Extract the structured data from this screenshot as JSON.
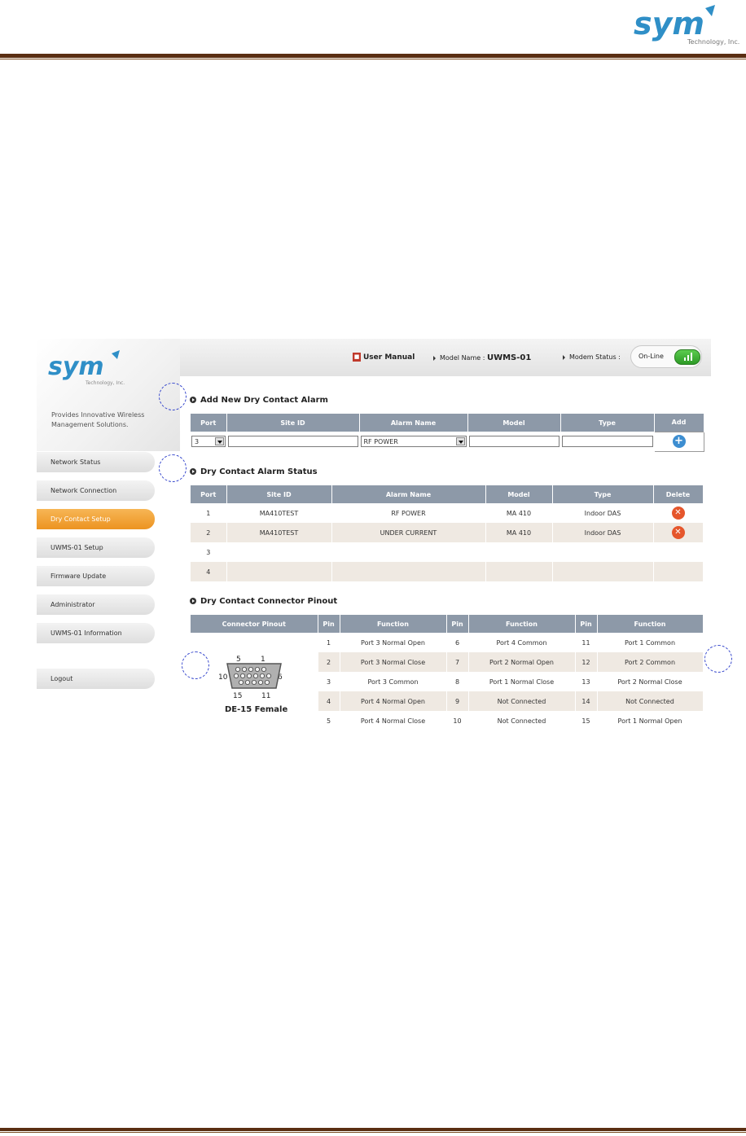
{
  "doc": {
    "logo_text": "sym",
    "logo_sub": "Technology, Inc."
  },
  "brand": {
    "logo_text": "sym",
    "logo_sub": "Technology, Inc.",
    "tagline": "Provides Innovative Wireless Management Solutions."
  },
  "header": {
    "user_manual": "User Manual",
    "model_label": "Model Name :",
    "model_value": "UWMS-01",
    "modem_label": "Modem Status :",
    "modem_value": "On-Line"
  },
  "sidebar": {
    "items": [
      {
        "label": "Network Status"
      },
      {
        "label": "Network Connection"
      },
      {
        "label": "Dry Contact Setup",
        "active": true
      },
      {
        "label": "UWMS-01 Setup"
      },
      {
        "label": "Firmware Update"
      },
      {
        "label": "Administrator"
      },
      {
        "label": "UWMS-01 Information"
      }
    ],
    "logout": "Logout"
  },
  "add_section": {
    "title": "Add New Dry Contact Alarm",
    "columns": [
      "Port",
      "Site ID",
      "Alarm Name",
      "Model",
      "Type",
      "Add"
    ],
    "port_value": "3",
    "site_id_value": "",
    "alarm_value": "RF POWER",
    "model_value": "",
    "type_value": "",
    "add_icon": "plus-icon"
  },
  "status_section": {
    "title": "Dry Contact Alarm Status",
    "columns": [
      "Port",
      "Site ID",
      "Alarm Name",
      "Model",
      "Type",
      "Delete"
    ],
    "rows": [
      {
        "port": "1",
        "site_id": "MA410TEST",
        "alarm": "RF POWER",
        "model": "MA 410",
        "type": "Indoor DAS",
        "deletable": true
      },
      {
        "port": "2",
        "site_id": "MA410TEST",
        "alarm": "UNDER CURRENT",
        "model": "MA 410",
        "type": "Indoor DAS",
        "deletable": true
      },
      {
        "port": "3",
        "site_id": "",
        "alarm": "",
        "model": "",
        "type": "",
        "deletable": false
      },
      {
        "port": "4",
        "site_id": "",
        "alarm": "",
        "model": "",
        "type": "",
        "deletable": false
      }
    ]
  },
  "pinout_section": {
    "title": "Dry Contact Connector Pinout",
    "columns": [
      "Connector Pinout",
      "Pin",
      "Function",
      "Pin",
      "Function",
      "Pin",
      "Function"
    ],
    "connector_label": "DE-15 Female",
    "connector_pins": {
      "top_left": "5",
      "top_right": "1",
      "mid_left": "10",
      "mid_right": "6",
      "bot_left": "15",
      "bot_right": "11"
    },
    "rows": [
      {
        "p1": "1",
        "f1": "Port 3 Normal Open",
        "p2": "6",
        "f2": "Port 4 Common",
        "p3": "11",
        "f3": "Port 1 Common"
      },
      {
        "p1": "2",
        "f1": "Port 3 Normal Close",
        "p2": "7",
        "f2": "Port 2 Normal Open",
        "p3": "12",
        "f3": "Port 2 Common"
      },
      {
        "p1": "3",
        "f1": "Port 3 Common",
        "p2": "8",
        "f2": "Port 1 Normal Close",
        "p3": "13",
        "f3": "Port 2 Normal Close"
      },
      {
        "p1": "4",
        "f1": "Port 4 Normal Open",
        "p2": "9",
        "f2": "Not Connected",
        "p3": "14",
        "f3": "Not Connected"
      },
      {
        "p1": "5",
        "f1": "Port 4 Normal Close",
        "p2": "10",
        "f2": "Not Connected",
        "p3": "15",
        "f3": "Port 1 Normal Open"
      }
    ]
  },
  "colors": {
    "accent": "#ec9321",
    "header_gray": "#8d99a8",
    "row_alt": "#efe9e2",
    "rule": "#5a2e12"
  }
}
